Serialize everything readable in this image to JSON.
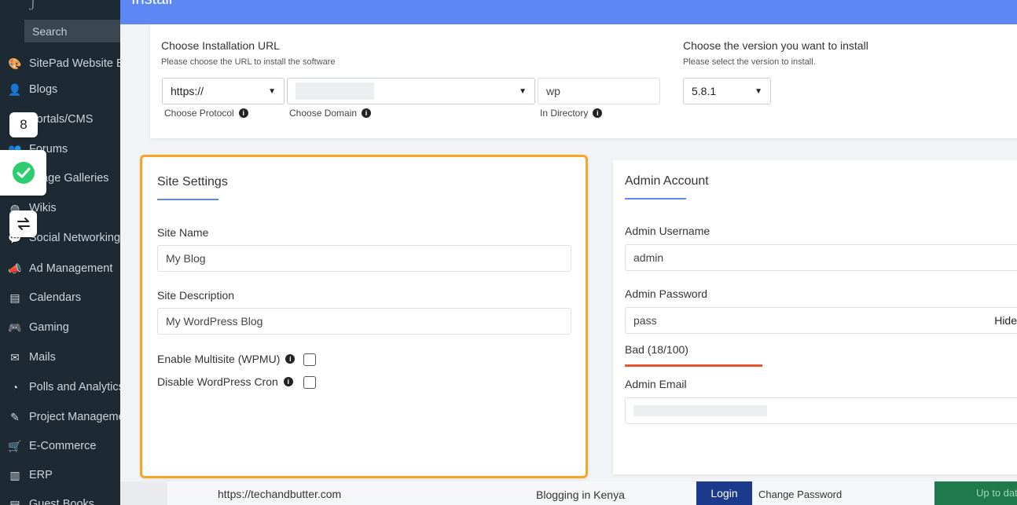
{
  "sidebar": {
    "logo": "ʃ",
    "search": "Search",
    "items": [
      {
        "icon": "palette-icon",
        "glyph": "🎨",
        "label": "SitePad Website Builder"
      },
      {
        "icon": "user-icon",
        "glyph": "👤",
        "label": "Blogs"
      },
      {
        "icon": "grid-icon",
        "glyph": "▦",
        "label": "Portals/CMS"
      },
      {
        "icon": "users-icon",
        "glyph": "👥",
        "label": "Forums"
      },
      {
        "icon": "image-icon",
        "glyph": "▣",
        "label": "Image Galleries"
      },
      {
        "icon": "globe-icon",
        "glyph": "◍",
        "label": "Wikis"
      },
      {
        "icon": "chat-icon",
        "glyph": "💬",
        "label": "Social Networking"
      },
      {
        "icon": "megaphone-icon",
        "glyph": "📣",
        "label": "Ad Management"
      },
      {
        "icon": "calendar-icon",
        "glyph": "▤",
        "label": "Calendars"
      },
      {
        "icon": "gamepad-icon",
        "glyph": "🎮",
        "label": "Gaming"
      },
      {
        "icon": "mail-icon",
        "glyph": "✉",
        "label": "Mails"
      },
      {
        "icon": "pie-chart-icon",
        "glyph": "◔",
        "label": "Polls and Analytics"
      },
      {
        "icon": "edit-icon",
        "glyph": "✎",
        "label": "Project Management"
      },
      {
        "icon": "cart-icon",
        "glyph": "🛒",
        "label": "E-Commerce"
      },
      {
        "icon": "bar-chart-icon",
        "glyph": "▥",
        "label": "ERP"
      },
      {
        "icon": "book-icon",
        "glyph": "▤",
        "label": "Guest Books"
      }
    ],
    "widgets": {
      "badge_number": "8"
    }
  },
  "header": {
    "title": "Install"
  },
  "install_url": {
    "title": "Choose Installation URL",
    "subtitle": "Please choose the URL to install the software",
    "protocol": {
      "value": "https://",
      "caption": "Choose Protocol"
    },
    "domain": {
      "value": "",
      "caption": "Choose Domain"
    },
    "directory": {
      "value": "wp",
      "caption": "In Directory"
    }
  },
  "version": {
    "title": "Choose the version you want to install",
    "subtitle": "Please select the version to install.",
    "value": "5.8.1"
  },
  "site_settings": {
    "title": "Site Settings",
    "site_name_label": "Site Name",
    "site_name_value": "My Blog",
    "site_desc_label": "Site Description",
    "site_desc_value": "My WordPress Blog",
    "multisite_label": "Enable Multisite (WPMU)",
    "cron_label": "Disable WordPress Cron"
  },
  "admin_account": {
    "title": "Admin Account",
    "username_label": "Admin Username",
    "username_value": "admin",
    "password_label": "Admin Password",
    "password_value": "pass",
    "hide_label": "Hide",
    "strength": "Bad (18/100)",
    "strength_color": "#e8562f",
    "email_label": "Admin Email",
    "email_value": ""
  },
  "footer": {
    "url": "https://techandbutter.com",
    "site_title": "Blogging in Kenya",
    "login_label": "Login",
    "change_password_label": "Change Password",
    "status_label": "Up to date"
  },
  "colors": {
    "accent": "#5d87f2",
    "highlight": "#f5a623",
    "success": "#2ecc71"
  }
}
